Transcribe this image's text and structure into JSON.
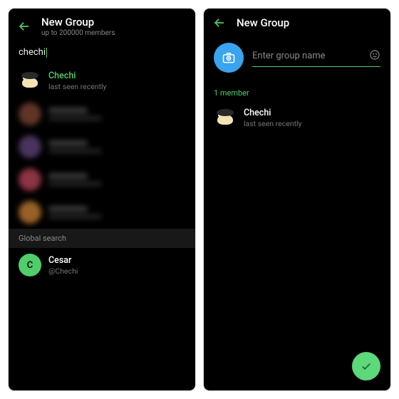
{
  "left": {
    "title": "New Group",
    "subtitle": "up to 200000 members",
    "search_query": "chechi",
    "top_result": {
      "name": "Chechi",
      "status": "last seen recently"
    },
    "global_search_label": "Global search",
    "global_result": {
      "initial": "C",
      "name": "Cesar",
      "handle": "@Chechi"
    }
  },
  "right": {
    "title": "New Group",
    "name_placeholder": "Enter group name",
    "members_label": "1 member",
    "member": {
      "name": "Chechi",
      "status": "last seen recently"
    }
  }
}
